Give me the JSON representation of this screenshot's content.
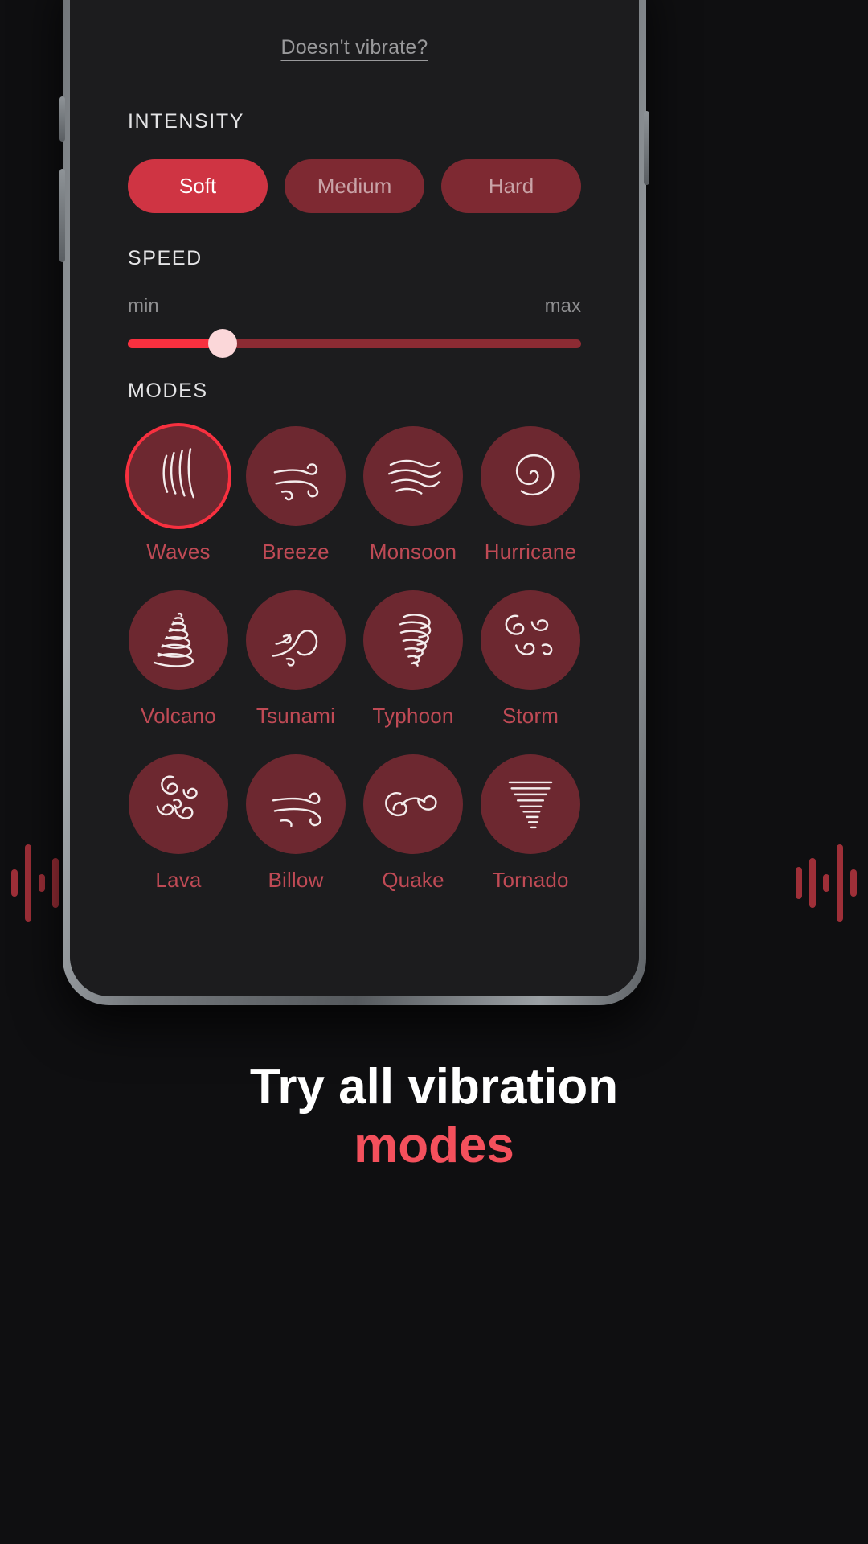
{
  "help_link": "Doesn't vibrate?",
  "intensity": {
    "title": "INTENSITY",
    "options": [
      {
        "label": "Soft",
        "selected": true
      },
      {
        "label": "Medium",
        "selected": false
      },
      {
        "label": "Hard",
        "selected": false
      }
    ]
  },
  "speed": {
    "title": "SPEED",
    "min_label": "min",
    "max_label": "max",
    "value_percent": 21
  },
  "modes": {
    "title": "MODES",
    "items": [
      {
        "label": "Waves",
        "icon": "waves-icon",
        "selected": true
      },
      {
        "label": "Breeze",
        "icon": "breeze-icon",
        "selected": false
      },
      {
        "label": "Monsoon",
        "icon": "monsoon-icon",
        "selected": false
      },
      {
        "label": "Hurricane",
        "icon": "hurricane-icon",
        "selected": false
      },
      {
        "label": "Volcano",
        "icon": "volcano-icon",
        "selected": false
      },
      {
        "label": "Tsunami",
        "icon": "tsunami-icon",
        "selected": false
      },
      {
        "label": "Typhoon",
        "icon": "typhoon-icon",
        "selected": false
      },
      {
        "label": "Storm",
        "icon": "storm-icon",
        "selected": false
      },
      {
        "label": "Lava",
        "icon": "lava-icon",
        "selected": false
      },
      {
        "label": "Billow",
        "icon": "billow-icon",
        "selected": false
      },
      {
        "label": "Quake",
        "icon": "quake-icon",
        "selected": false
      },
      {
        "label": "Tornado",
        "icon": "tornado-icon",
        "selected": false
      }
    ]
  },
  "caption": {
    "line1": "Try all vibration",
    "line2": "modes"
  },
  "colors": {
    "accent": "#f8303f",
    "chip_selected": "#cf3443",
    "chip_unselected": "#7e2932",
    "circle": "#6d2830",
    "label": "#bf4a55",
    "screen_bg": "#1c1c1e",
    "page_bg": "#0f0f11"
  },
  "decoration": {
    "left_bars": [
      34,
      96,
      22,
      62,
      40
    ],
    "right_bars": [
      40,
      62,
      22,
      96,
      34
    ]
  }
}
